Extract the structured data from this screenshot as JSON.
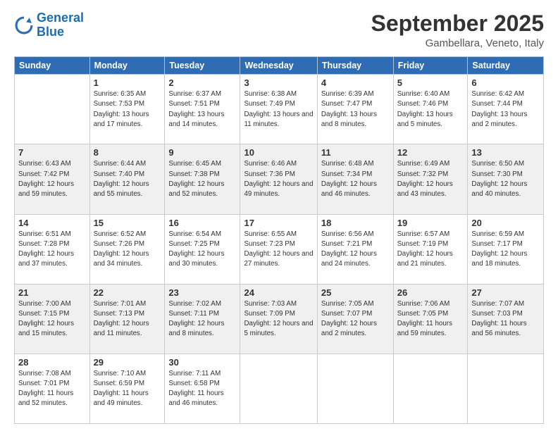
{
  "logo": {
    "line1": "General",
    "line2": "Blue"
  },
  "title": "September 2025",
  "location": "Gambellara, Veneto, Italy",
  "days_of_week": [
    "Sunday",
    "Monday",
    "Tuesday",
    "Wednesday",
    "Thursday",
    "Friday",
    "Saturday"
  ],
  "weeks": [
    [
      {
        "day": "",
        "sunrise": "",
        "sunset": "",
        "daylight": ""
      },
      {
        "day": "1",
        "sunrise": "Sunrise: 6:35 AM",
        "sunset": "Sunset: 7:53 PM",
        "daylight": "Daylight: 13 hours and 17 minutes."
      },
      {
        "day": "2",
        "sunrise": "Sunrise: 6:37 AM",
        "sunset": "Sunset: 7:51 PM",
        "daylight": "Daylight: 13 hours and 14 minutes."
      },
      {
        "day": "3",
        "sunrise": "Sunrise: 6:38 AM",
        "sunset": "Sunset: 7:49 PM",
        "daylight": "Daylight: 13 hours and 11 minutes."
      },
      {
        "day": "4",
        "sunrise": "Sunrise: 6:39 AM",
        "sunset": "Sunset: 7:47 PM",
        "daylight": "Daylight: 13 hours and 8 minutes."
      },
      {
        "day": "5",
        "sunrise": "Sunrise: 6:40 AM",
        "sunset": "Sunset: 7:46 PM",
        "daylight": "Daylight: 13 hours and 5 minutes."
      },
      {
        "day": "6",
        "sunrise": "Sunrise: 6:42 AM",
        "sunset": "Sunset: 7:44 PM",
        "daylight": "Daylight: 13 hours and 2 minutes."
      }
    ],
    [
      {
        "day": "7",
        "sunrise": "Sunrise: 6:43 AM",
        "sunset": "Sunset: 7:42 PM",
        "daylight": "Daylight: 12 hours and 59 minutes."
      },
      {
        "day": "8",
        "sunrise": "Sunrise: 6:44 AM",
        "sunset": "Sunset: 7:40 PM",
        "daylight": "Daylight: 12 hours and 55 minutes."
      },
      {
        "day": "9",
        "sunrise": "Sunrise: 6:45 AM",
        "sunset": "Sunset: 7:38 PM",
        "daylight": "Daylight: 12 hours and 52 minutes."
      },
      {
        "day": "10",
        "sunrise": "Sunrise: 6:46 AM",
        "sunset": "Sunset: 7:36 PM",
        "daylight": "Daylight: 12 hours and 49 minutes."
      },
      {
        "day": "11",
        "sunrise": "Sunrise: 6:48 AM",
        "sunset": "Sunset: 7:34 PM",
        "daylight": "Daylight: 12 hours and 46 minutes."
      },
      {
        "day": "12",
        "sunrise": "Sunrise: 6:49 AM",
        "sunset": "Sunset: 7:32 PM",
        "daylight": "Daylight: 12 hours and 43 minutes."
      },
      {
        "day": "13",
        "sunrise": "Sunrise: 6:50 AM",
        "sunset": "Sunset: 7:30 PM",
        "daylight": "Daylight: 12 hours and 40 minutes."
      }
    ],
    [
      {
        "day": "14",
        "sunrise": "Sunrise: 6:51 AM",
        "sunset": "Sunset: 7:28 PM",
        "daylight": "Daylight: 12 hours and 37 minutes."
      },
      {
        "day": "15",
        "sunrise": "Sunrise: 6:52 AM",
        "sunset": "Sunset: 7:26 PM",
        "daylight": "Daylight: 12 hours and 34 minutes."
      },
      {
        "day": "16",
        "sunrise": "Sunrise: 6:54 AM",
        "sunset": "Sunset: 7:25 PM",
        "daylight": "Daylight: 12 hours and 30 minutes."
      },
      {
        "day": "17",
        "sunrise": "Sunrise: 6:55 AM",
        "sunset": "Sunset: 7:23 PM",
        "daylight": "Daylight: 12 hours and 27 minutes."
      },
      {
        "day": "18",
        "sunrise": "Sunrise: 6:56 AM",
        "sunset": "Sunset: 7:21 PM",
        "daylight": "Daylight: 12 hours and 24 minutes."
      },
      {
        "day": "19",
        "sunrise": "Sunrise: 6:57 AM",
        "sunset": "Sunset: 7:19 PM",
        "daylight": "Daylight: 12 hours and 21 minutes."
      },
      {
        "day": "20",
        "sunrise": "Sunrise: 6:59 AM",
        "sunset": "Sunset: 7:17 PM",
        "daylight": "Daylight: 12 hours and 18 minutes."
      }
    ],
    [
      {
        "day": "21",
        "sunrise": "Sunrise: 7:00 AM",
        "sunset": "Sunset: 7:15 PM",
        "daylight": "Daylight: 12 hours and 15 minutes."
      },
      {
        "day": "22",
        "sunrise": "Sunrise: 7:01 AM",
        "sunset": "Sunset: 7:13 PM",
        "daylight": "Daylight: 12 hours and 11 minutes."
      },
      {
        "day": "23",
        "sunrise": "Sunrise: 7:02 AM",
        "sunset": "Sunset: 7:11 PM",
        "daylight": "Daylight: 12 hours and 8 minutes."
      },
      {
        "day": "24",
        "sunrise": "Sunrise: 7:03 AM",
        "sunset": "Sunset: 7:09 PM",
        "daylight": "Daylight: 12 hours and 5 minutes."
      },
      {
        "day": "25",
        "sunrise": "Sunrise: 7:05 AM",
        "sunset": "Sunset: 7:07 PM",
        "daylight": "Daylight: 12 hours and 2 minutes."
      },
      {
        "day": "26",
        "sunrise": "Sunrise: 7:06 AM",
        "sunset": "Sunset: 7:05 PM",
        "daylight": "Daylight: 11 hours and 59 minutes."
      },
      {
        "day": "27",
        "sunrise": "Sunrise: 7:07 AM",
        "sunset": "Sunset: 7:03 PM",
        "daylight": "Daylight: 11 hours and 56 minutes."
      }
    ],
    [
      {
        "day": "28",
        "sunrise": "Sunrise: 7:08 AM",
        "sunset": "Sunset: 7:01 PM",
        "daylight": "Daylight: 11 hours and 52 minutes."
      },
      {
        "day": "29",
        "sunrise": "Sunrise: 7:10 AM",
        "sunset": "Sunset: 6:59 PM",
        "daylight": "Daylight: 11 hours and 49 minutes."
      },
      {
        "day": "30",
        "sunrise": "Sunrise: 7:11 AM",
        "sunset": "Sunset: 6:58 PM",
        "daylight": "Daylight: 11 hours and 46 minutes."
      },
      {
        "day": "",
        "sunrise": "",
        "sunset": "",
        "daylight": ""
      },
      {
        "day": "",
        "sunrise": "",
        "sunset": "",
        "daylight": ""
      },
      {
        "day": "",
        "sunrise": "",
        "sunset": "",
        "daylight": ""
      },
      {
        "day": "",
        "sunrise": "",
        "sunset": "",
        "daylight": ""
      }
    ]
  ]
}
